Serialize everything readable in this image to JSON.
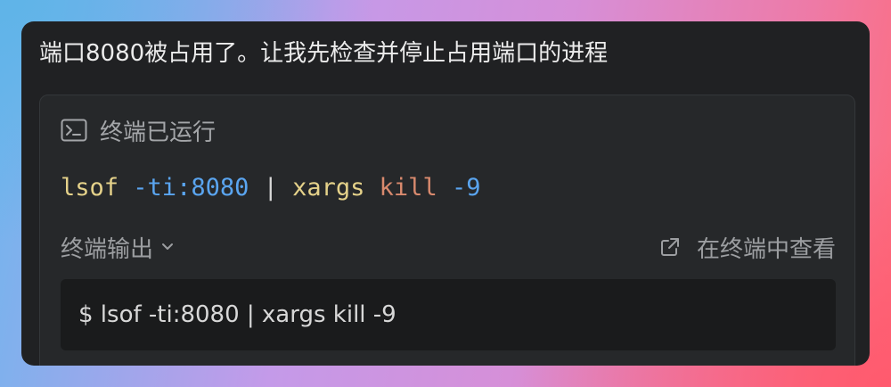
{
  "message": "端口8080被占用了。让我先检查并停止占用端口的进程",
  "terminal": {
    "icon": "terminal-icon",
    "status": "终端已运行",
    "command_tokens": [
      {
        "text": "lsof",
        "color": "#e5d28a"
      },
      {
        "text": " ",
        "color": "#d8d8d8"
      },
      {
        "text": "-ti:8080",
        "color": "#5aa5f0"
      },
      {
        "text": " | ",
        "color": "#d8d8d8"
      },
      {
        "text": "xargs",
        "color": "#e5d28a"
      },
      {
        "text": " ",
        "color": "#d8d8d8"
      },
      {
        "text": "kill",
        "color": "#d98a6e"
      },
      {
        "text": " ",
        "color": "#d8d8d8"
      },
      {
        "text": "-9",
        "color": "#5aa5f0"
      }
    ],
    "output_label": "终端输出",
    "view_in_terminal_label": "在终端中查看",
    "output_text": "$ lsof -ti:8080 | xargs kill -9"
  }
}
